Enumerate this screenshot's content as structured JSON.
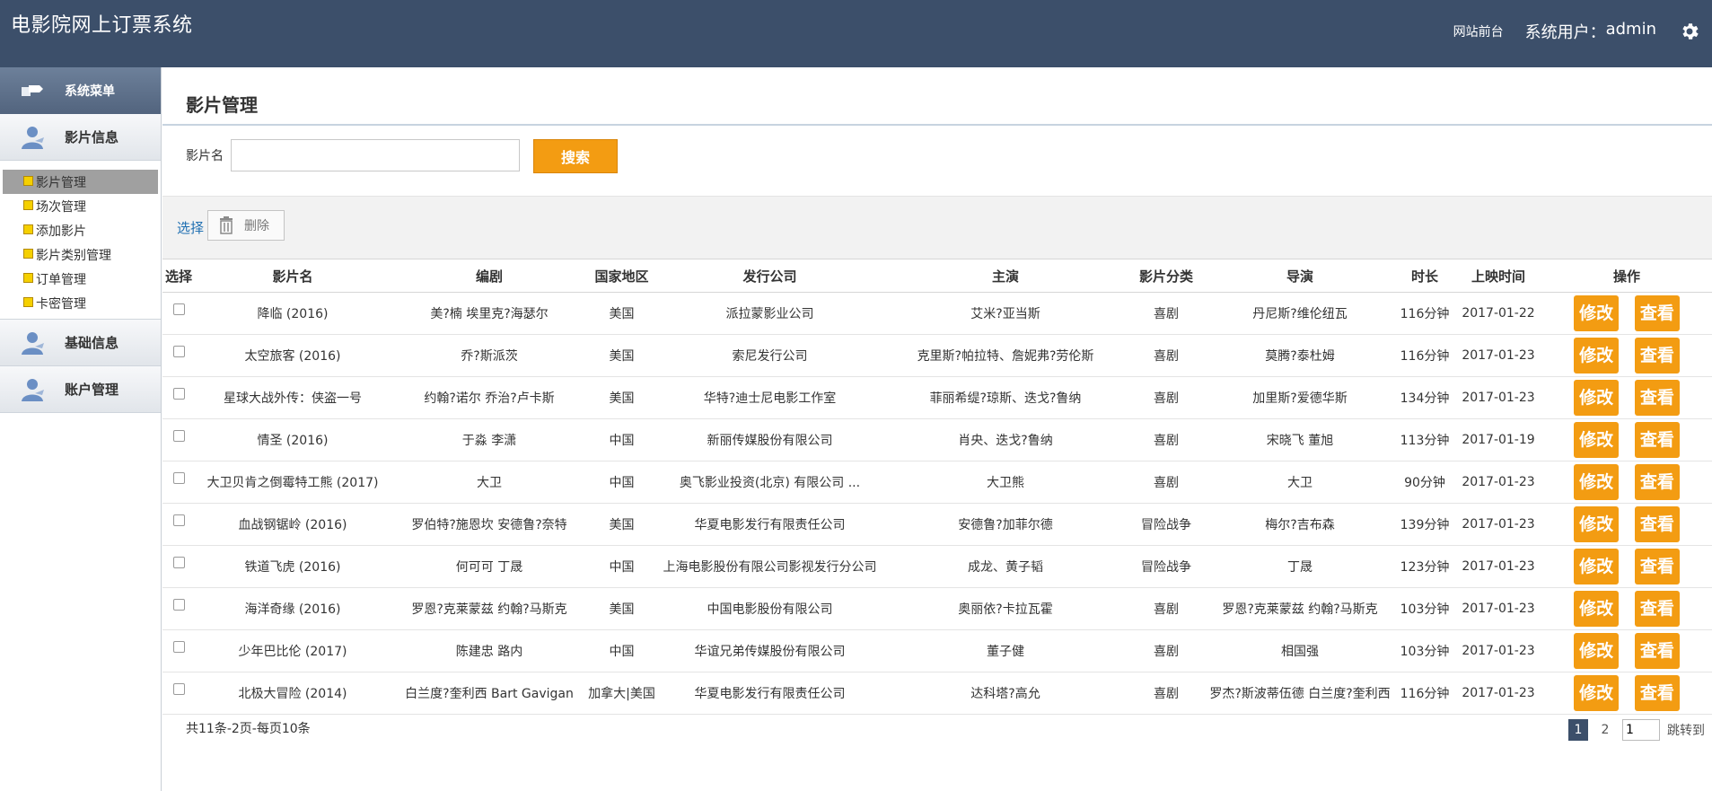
{
  "header": {
    "title": "电影院网上订票系统",
    "frontend_link": "网站前台",
    "user_label": "系统用户：",
    "user_name": "admin"
  },
  "sidebar": {
    "menu_title": "系统菜单",
    "sections": [
      {
        "label": "影片信息"
      },
      {
        "label": "基础信息"
      },
      {
        "label": "账户管理"
      }
    ],
    "items": [
      {
        "label": "影片管理"
      },
      {
        "label": "场次管理"
      },
      {
        "label": "添加影片"
      },
      {
        "label": "影片类别管理"
      },
      {
        "label": "订单管理"
      },
      {
        "label": "卡密管理"
      }
    ]
  },
  "main": {
    "page_title": "影片管理",
    "search_label": "影片名",
    "search_value": "",
    "search_button": "搜索",
    "select_link": "选择",
    "delete_button": "删除"
  },
  "table": {
    "headers": [
      "选择",
      "影片名",
      "编剧",
      "国家地区",
      "发行公司",
      "主演",
      "影片分类",
      "导演",
      "时长",
      "上映时间",
      "操作"
    ],
    "edit_label": "修改",
    "view_label": "查看",
    "rows": [
      {
        "name": "降临 (2016)",
        "writer": "美?楠 埃里克?海瑟尔",
        "country": "美国",
        "company": "派拉蒙影业公司",
        "cast": "艾米?亚当斯",
        "genre": "喜剧",
        "director": "丹尼斯?维伦纽瓦",
        "duration": "116分钟",
        "date": "2017-01-22"
      },
      {
        "name": "太空旅客 (2016)",
        "writer": "乔?斯派茨",
        "country": "美国",
        "company": "索尼发行公司",
        "cast": "克里斯?帕拉特、詹妮弗?劳伦斯",
        "genre": "喜剧",
        "director": "莫腾?泰杜姆",
        "duration": "116分钟",
        "date": "2017-01-23"
      },
      {
        "name": "星球大战外传：侠盗一号",
        "writer": "约翰?诺尔 乔治?卢卡斯",
        "country": "美国",
        "company": "华特?迪士尼电影工作室",
        "cast": "菲丽希缇?琼斯、迭戈?鲁纳",
        "genre": "喜剧",
        "director": "加里斯?爱德华斯",
        "duration": "134分钟",
        "date": "2017-01-23"
      },
      {
        "name": "情圣 (2016)",
        "writer": "于淼 李潇",
        "country": "中国",
        "company": "新丽传媒股份有限公司",
        "cast": "肖央、迭戈?鲁纳",
        "genre": "喜剧",
        "director": "宋晓飞 董旭",
        "duration": "113分钟",
        "date": "2017-01-19"
      },
      {
        "name": "大卫贝肯之倒霉特工熊 (2017)",
        "writer": "大卫",
        "country": "中国",
        "company": "奥飞影业投资(北京) 有限公司 ...",
        "cast": "大卫熊",
        "genre": "喜剧",
        "director": "大卫",
        "duration": "90分钟",
        "date": "2017-01-23"
      },
      {
        "name": "血战钢锯岭 (2016)",
        "writer": "罗伯特?施恩坎 安德鲁?奈特",
        "country": "美国",
        "company": "华夏电影发行有限责任公司",
        "cast": "安德鲁?加菲尔德",
        "genre": "冒险战争",
        "director": "梅尔?吉布森",
        "duration": "139分钟",
        "date": "2017-01-23"
      },
      {
        "name": "铁道飞虎 (2016)",
        "writer": "何可可 丁晟",
        "country": "中国",
        "company": "上海电影股份有限公司影视发行分公司",
        "cast": "成龙、黄子韬",
        "genre": "冒险战争",
        "director": "丁晟",
        "duration": "123分钟",
        "date": "2017-01-23"
      },
      {
        "name": "海洋奇缘 (2016)",
        "writer": "罗恩?克莱蒙兹 约翰?马斯克",
        "country": "美国",
        "company": "中国电影股份有限公司",
        "cast": "奥丽依?卡拉瓦霍",
        "genre": "喜剧",
        "director": "罗恩?克莱蒙兹 约翰?马斯克",
        "duration": "103分钟",
        "date": "2017-01-23"
      },
      {
        "name": "少年巴比伦 (2017)",
        "writer": "陈建忠 路内",
        "country": "中国",
        "company": "华谊兄弟传媒股份有限公司",
        "cast": "董子健",
        "genre": "喜剧",
        "director": "相国强",
        "duration": "103分钟",
        "date": "2017-01-23"
      },
      {
        "name": "北极大冒险 (2014)",
        "writer": "白兰度?奎利西 Bart Gavigan",
        "country": "加拿大|美国",
        "company": "华夏电影发行有限责任公司",
        "cast": "达科塔?高允",
        "genre": "喜剧",
        "director": "罗杰?斯波蒂伍德 白兰度?奎利西",
        "duration": "116分钟",
        "date": "2017-01-23"
      }
    ]
  },
  "pagination": {
    "summary": "共11条-2页-每页10条",
    "pages": [
      "1",
      "2"
    ],
    "current": "1",
    "jump_value": "1",
    "jump_label": "跳转到"
  },
  "colors": {
    "header_bg": "#3c4f6a",
    "accent": "#f39c12",
    "link": "#1f6fb2"
  }
}
